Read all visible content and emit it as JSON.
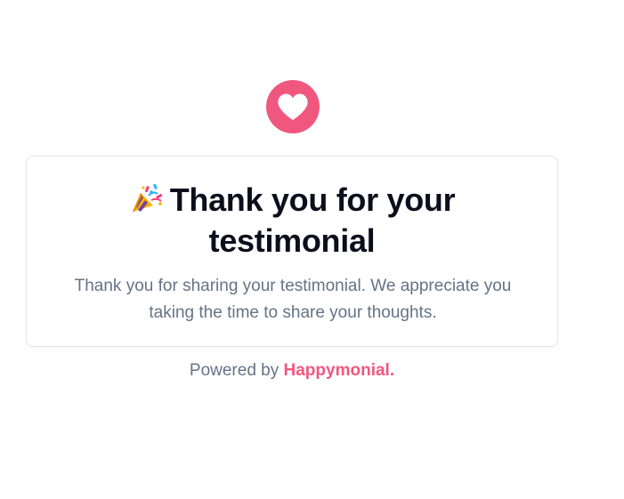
{
  "colors": {
    "accent": "#f0577f",
    "title_text": "#0b0f1c",
    "body_text": "#647387",
    "card_border": "#e3e6ea"
  },
  "header": {
    "badge_icon": "heart-icon"
  },
  "card": {
    "title_icon": "party-popper-icon",
    "title_line1": "Thank you for your",
    "title_line2": "testimonial",
    "message": "Thank you for sharing your testimonial. We appreciate you taking the time to share your thoughts."
  },
  "footer": {
    "powered_by_label": "Powered by",
    "brand_name": "Happymonial."
  }
}
